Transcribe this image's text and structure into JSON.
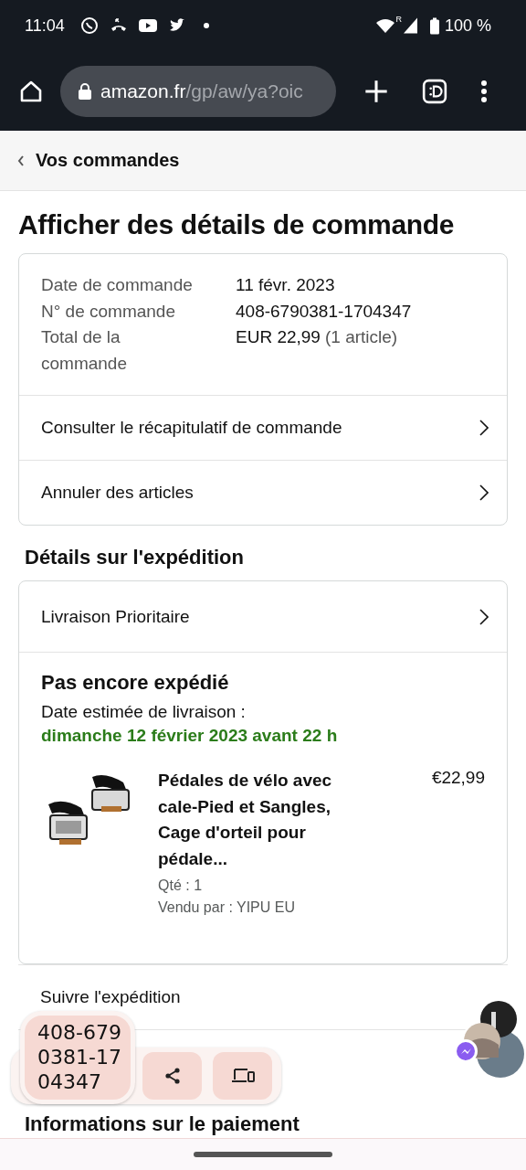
{
  "status_bar": {
    "time": "11:04",
    "signal_mark": "R",
    "battery": "100 %"
  },
  "browser": {
    "url_host": "amazon.fr",
    "url_path": "/gp/aw/ya?oic"
  },
  "breadcrumb": {
    "label": "Vos commandes"
  },
  "title": "Afficher des détails de commande",
  "summary": {
    "fields": [
      {
        "label": "Date de commande",
        "value": "11 févr. 2023"
      },
      {
        "label": "N° de commande",
        "value": "408-6790381-1704347"
      },
      {
        "label": "Total de la commande",
        "value": "EUR 22,99",
        "note": "(1 article)"
      }
    ],
    "links": [
      "Consulter le récapitulatif de commande",
      "Annuler des articles"
    ]
  },
  "shipping": {
    "heading": "Détails sur l'expédition",
    "method": "Livraison Prioritaire",
    "status": "Pas encore expédié",
    "eta_label": "Date estimée de livraison :",
    "eta": "dimanche 12 février 2023 avant 22 h",
    "item": {
      "kind": "picture",
      "name": "Pédales de vélo avec cale-Pied et Sangles, Cage d'orteil pour pédale...",
      "price": "€22,99",
      "qty": "Qté : 1",
      "seller": "Vendu par : YIPU EU"
    }
  },
  "track_link": "Suivre l'expédition",
  "payment_heading": "Informations sur le paiement",
  "clipboard_popup": {
    "text": "408-679\n0381-17\n04347"
  }
}
